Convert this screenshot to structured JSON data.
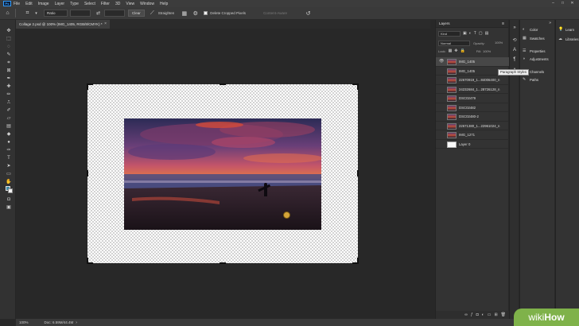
{
  "menubar": {
    "app_icon": "Ps",
    "items": [
      "File",
      "Edit",
      "Image",
      "Layer",
      "Type",
      "Select",
      "Filter",
      "3D",
      "View",
      "Window",
      "Help"
    ],
    "window_controls": [
      "–",
      "□",
      "✕"
    ]
  },
  "options_bar": {
    "ratio_select": "Ratio",
    "clear_label": "Clear",
    "straighten_label": "Straighten",
    "delete_cropped_label": "Delete Cropped Pixels",
    "content_aware_label": "Content-Aware"
  },
  "document": {
    "tab_title": "Collage 2.psd @ 100% (IMG_1405, RGB/8/CMYK) *",
    "close_glyph": "×"
  },
  "status_bar": {
    "zoom": "100%",
    "doc_info": "Doc: 6.59M/44.4M"
  },
  "layers_panel": {
    "title": "Layers",
    "filter_select": "Kind",
    "blend_select": "Normal",
    "opacity_label": "Opacity:",
    "opacity_value": "100%",
    "lock_label": "Lock:",
    "fill_label": "Fill:",
    "fill_value": "100%",
    "layers": [
      {
        "name": "IMG_1405",
        "thumb": "photo",
        "selected": true,
        "visible": true
      },
      {
        "name": "IMG_1405",
        "thumb": "photo",
        "selected": false,
        "visible": false
      },
      {
        "name": "22670919_1...84006400_n",
        "thumb": "photo",
        "selected": false,
        "visible": false
      },
      {
        "name": "24232684_1...28726128_n",
        "thumb": "photo",
        "selected": false,
        "visible": false
      },
      {
        "name": "DSC02479",
        "thumb": "photo",
        "selected": false,
        "visible": false
      },
      {
        "name": "DSC02482",
        "thumb": "photo",
        "selected": false,
        "visible": false
      },
      {
        "name": "DSC02480-2",
        "thumb": "photo",
        "selected": false,
        "visible": false
      },
      {
        "name": "22671380_1...22961024_n",
        "thumb": "photo",
        "selected": false,
        "visible": false
      },
      {
        "name": "IMG_1271",
        "thumb": "photo",
        "selected": false,
        "visible": false
      },
      {
        "name": "Layer 0",
        "thumb": "white",
        "selected": false,
        "visible": false
      }
    ],
    "footer_icons": [
      "link-icon",
      "fx-icon",
      "mask-icon",
      "adjustment-icon",
      "group-icon",
      "new-layer-icon",
      "trash-icon"
    ]
  },
  "side_panels": {
    "items": [
      {
        "label": "Color",
        "icon": "color-icon"
      },
      {
        "label": "Swatches",
        "icon": "swatches-icon"
      },
      {
        "label": "Properties",
        "icon": "properties-icon"
      },
      {
        "label": "Adjustments",
        "icon": "adjustments-icon"
      },
      {
        "label": "Channels",
        "icon": "channels-icon"
      },
      {
        "label": "Paths",
        "icon": "paths-icon"
      }
    ],
    "right_items": [
      {
        "label": "Learn",
        "icon": "learn-icon"
      },
      {
        "label": "Libraries",
        "icon": "libraries-icon"
      }
    ]
  },
  "tooltip": "Paragraph Styles",
  "watermark": {
    "part1": "wiki",
    "part2": "How"
  },
  "colors": {
    "foreground_swatch": "#3d8aa6",
    "background_swatch": "#f4f4f4",
    "watermark_green": "#7fb24a"
  }
}
